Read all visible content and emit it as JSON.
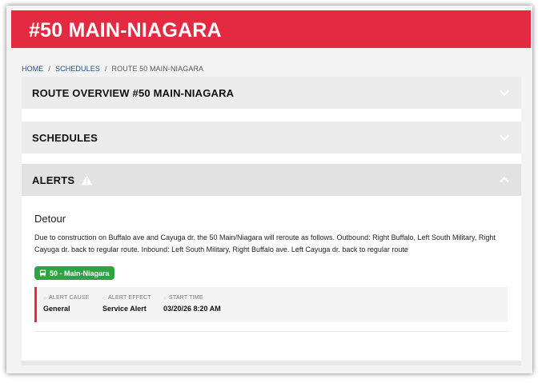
{
  "page": {
    "title": "#50 MAIN-NIAGARA"
  },
  "breadcrumb": {
    "home": "HOME",
    "schedules": "SCHEDULES",
    "current": "ROUTE 50 MAIN-NIAGARA",
    "separator": "/"
  },
  "accordion": {
    "overview": {
      "label": "ROUTE OVERVIEW #50 MAIN-NIAGARA",
      "icon": "chevron-down-icon"
    },
    "schedules": {
      "label": "SCHEDULES",
      "icon": "chevron-down-icon"
    },
    "alerts": {
      "label": "ALERTS",
      "icon": "chevron-up-icon",
      "status_icon": "warning-icon"
    }
  },
  "alert": {
    "title": "Detour",
    "body": "Due to construction on Buffalo ave and Cayuga dr. the 50 Main/Niagara will reroute as follows. Outbound: Right Buffalo, Left South Military, Right Cayuga dr. back to regular route. Inbound: Left South Military, Right Buffalo ave. Left Cayuga dr. back to regular route",
    "route_badge": "50 - Main-Niagara",
    "route_badge_icon": "bus-icon",
    "cause_label": "ALERT CAUSE",
    "cause_value": "General",
    "effect_label": "ALERT EFFECT",
    "effect_value": "Service Alert",
    "start_label": "START TIME",
    "start_value": "03/20/26 8:20 AM"
  },
  "colors": {
    "brand_red": "#e32a40",
    "badge_green": "#2ba441",
    "breadcrumb_link": "#1d4a8a"
  }
}
